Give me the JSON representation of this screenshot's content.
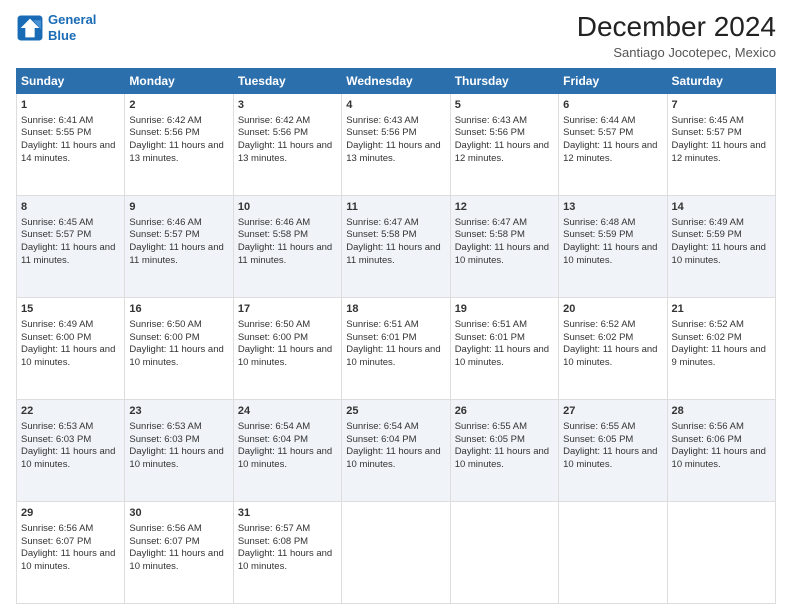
{
  "header": {
    "logo_line1": "General",
    "logo_line2": "Blue",
    "month_year": "December 2024",
    "location": "Santiago Jocotepec, Mexico"
  },
  "days_of_week": [
    "Sunday",
    "Monday",
    "Tuesday",
    "Wednesday",
    "Thursday",
    "Friday",
    "Saturday"
  ],
  "weeks": [
    [
      {
        "day": "1",
        "rise": "Sunrise: 6:41 AM",
        "set": "Sunset: 5:55 PM",
        "daylight": "Daylight: 11 hours and 14 minutes."
      },
      {
        "day": "2",
        "rise": "Sunrise: 6:42 AM",
        "set": "Sunset: 5:56 PM",
        "daylight": "Daylight: 11 hours and 13 minutes."
      },
      {
        "day": "3",
        "rise": "Sunrise: 6:42 AM",
        "set": "Sunset: 5:56 PM",
        "daylight": "Daylight: 11 hours and 13 minutes."
      },
      {
        "day": "4",
        "rise": "Sunrise: 6:43 AM",
        "set": "Sunset: 5:56 PM",
        "daylight": "Daylight: 11 hours and 13 minutes."
      },
      {
        "day": "5",
        "rise": "Sunrise: 6:43 AM",
        "set": "Sunset: 5:56 PM",
        "daylight": "Daylight: 11 hours and 12 minutes."
      },
      {
        "day": "6",
        "rise": "Sunrise: 6:44 AM",
        "set": "Sunset: 5:57 PM",
        "daylight": "Daylight: 11 hours and 12 minutes."
      },
      {
        "day": "7",
        "rise": "Sunrise: 6:45 AM",
        "set": "Sunset: 5:57 PM",
        "daylight": "Daylight: 11 hours and 12 minutes."
      }
    ],
    [
      {
        "day": "8",
        "rise": "Sunrise: 6:45 AM",
        "set": "Sunset: 5:57 PM",
        "daylight": "Daylight: 11 hours and 11 minutes."
      },
      {
        "day": "9",
        "rise": "Sunrise: 6:46 AM",
        "set": "Sunset: 5:57 PM",
        "daylight": "Daylight: 11 hours and 11 minutes."
      },
      {
        "day": "10",
        "rise": "Sunrise: 6:46 AM",
        "set": "Sunset: 5:58 PM",
        "daylight": "Daylight: 11 hours and 11 minutes."
      },
      {
        "day": "11",
        "rise": "Sunrise: 6:47 AM",
        "set": "Sunset: 5:58 PM",
        "daylight": "Daylight: 11 hours and 11 minutes."
      },
      {
        "day": "12",
        "rise": "Sunrise: 6:47 AM",
        "set": "Sunset: 5:58 PM",
        "daylight": "Daylight: 11 hours and 10 minutes."
      },
      {
        "day": "13",
        "rise": "Sunrise: 6:48 AM",
        "set": "Sunset: 5:59 PM",
        "daylight": "Daylight: 11 hours and 10 minutes."
      },
      {
        "day": "14",
        "rise": "Sunrise: 6:49 AM",
        "set": "Sunset: 5:59 PM",
        "daylight": "Daylight: 11 hours and 10 minutes."
      }
    ],
    [
      {
        "day": "15",
        "rise": "Sunrise: 6:49 AM",
        "set": "Sunset: 6:00 PM",
        "daylight": "Daylight: 11 hours and 10 minutes."
      },
      {
        "day": "16",
        "rise": "Sunrise: 6:50 AM",
        "set": "Sunset: 6:00 PM",
        "daylight": "Daylight: 11 hours and 10 minutes."
      },
      {
        "day": "17",
        "rise": "Sunrise: 6:50 AM",
        "set": "Sunset: 6:00 PM",
        "daylight": "Daylight: 11 hours and 10 minutes."
      },
      {
        "day": "18",
        "rise": "Sunrise: 6:51 AM",
        "set": "Sunset: 6:01 PM",
        "daylight": "Daylight: 11 hours and 10 minutes."
      },
      {
        "day": "19",
        "rise": "Sunrise: 6:51 AM",
        "set": "Sunset: 6:01 PM",
        "daylight": "Daylight: 11 hours and 10 minutes."
      },
      {
        "day": "20",
        "rise": "Sunrise: 6:52 AM",
        "set": "Sunset: 6:02 PM",
        "daylight": "Daylight: 11 hours and 10 minutes."
      },
      {
        "day": "21",
        "rise": "Sunrise: 6:52 AM",
        "set": "Sunset: 6:02 PM",
        "daylight": "Daylight: 11 hours and 9 minutes."
      }
    ],
    [
      {
        "day": "22",
        "rise": "Sunrise: 6:53 AM",
        "set": "Sunset: 6:03 PM",
        "daylight": "Daylight: 11 hours and 10 minutes."
      },
      {
        "day": "23",
        "rise": "Sunrise: 6:53 AM",
        "set": "Sunset: 6:03 PM",
        "daylight": "Daylight: 11 hours and 10 minutes."
      },
      {
        "day": "24",
        "rise": "Sunrise: 6:54 AM",
        "set": "Sunset: 6:04 PM",
        "daylight": "Daylight: 11 hours and 10 minutes."
      },
      {
        "day": "25",
        "rise": "Sunrise: 6:54 AM",
        "set": "Sunset: 6:04 PM",
        "daylight": "Daylight: 11 hours and 10 minutes."
      },
      {
        "day": "26",
        "rise": "Sunrise: 6:55 AM",
        "set": "Sunset: 6:05 PM",
        "daylight": "Daylight: 11 hours and 10 minutes."
      },
      {
        "day": "27",
        "rise": "Sunrise: 6:55 AM",
        "set": "Sunset: 6:05 PM",
        "daylight": "Daylight: 11 hours and 10 minutes."
      },
      {
        "day": "28",
        "rise": "Sunrise: 6:56 AM",
        "set": "Sunset: 6:06 PM",
        "daylight": "Daylight: 11 hours and 10 minutes."
      }
    ],
    [
      {
        "day": "29",
        "rise": "Sunrise: 6:56 AM",
        "set": "Sunset: 6:07 PM",
        "daylight": "Daylight: 11 hours and 10 minutes."
      },
      {
        "day": "30",
        "rise": "Sunrise: 6:56 AM",
        "set": "Sunset: 6:07 PM",
        "daylight": "Daylight: 11 hours and 10 minutes."
      },
      {
        "day": "31",
        "rise": "Sunrise: 6:57 AM",
        "set": "Sunset: 6:08 PM",
        "daylight": "Daylight: 11 hours and 10 minutes."
      },
      null,
      null,
      null,
      null
    ]
  ]
}
